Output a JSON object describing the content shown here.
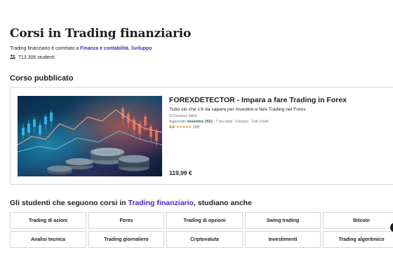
{
  "page": {
    "title": "Corsi in Trading finanziario",
    "related_prefix": "Trading finanziario è correlato a ",
    "related_links": [
      "Finanza e contabilità",
      "Sviluppo"
    ],
    "related_separator": ", ",
    "students": "713.306 studenti"
  },
  "published": {
    "section_title": "Corso pubblicato",
    "course": {
      "title": "FOREXDETECTOR - Impara a fare Trading in Forex",
      "description": "Tutto ciò che c'è da sapere per Investire e fare Trading nel Forex",
      "author": "Di Gianluca Sidoti",
      "updated_label": "Aggiornato ",
      "updated_value": "novembre 2021",
      "details": " · 7 ore totali · 9 lezioni · Tutti i livelli",
      "rating_value": "4,8",
      "stars": "★★★★★",
      "rating_count": "(98)",
      "price": "119,99 €"
    }
  },
  "also_studied": {
    "prefix": "Gli studenti che seguono corsi in ",
    "highlight": "Trading finanziario",
    "suffix": ", studiano anche",
    "topics": [
      "Trading di azioni",
      "Forex",
      "Trading di opzioni",
      "Swing trading",
      "Bitcoin",
      "Analisi tecnica",
      "Trading giornaliero",
      "Criptovaluta",
      "Investimenti",
      "Trading algoritmico"
    ]
  },
  "colors": {
    "link": "#5022c3",
    "updated_badge": "#1e6055",
    "rating": "#b4690e",
    "stars": "#e59819"
  },
  "icons": {
    "students": "users-icon",
    "next": "chevron-right-icon"
  }
}
